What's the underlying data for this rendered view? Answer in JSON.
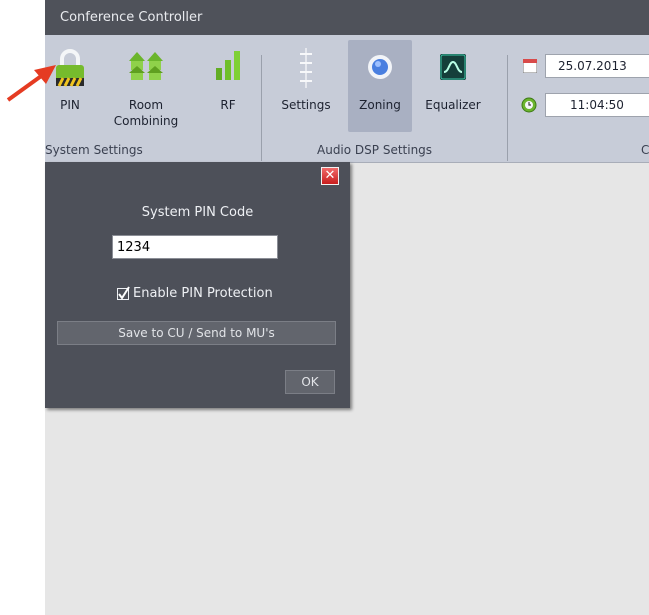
{
  "window": {
    "title": "Conference Controller"
  },
  "ribbon": {
    "buttons": [
      {
        "label": "PIN",
        "icon": "lock-icon"
      },
      {
        "label": "Room\nCombining",
        "icon": "room-combining-icon"
      },
      {
        "label": "RF",
        "icon": "signal-bars-icon"
      },
      {
        "label": "Settings",
        "icon": "sliders-icon"
      },
      {
        "label": "Zoning",
        "icon": "zoning-icon",
        "active": true
      },
      {
        "label": "Equalizer",
        "icon": "equalizer-icon"
      }
    ],
    "groups": [
      "System Settings",
      "Audio DSP Settings",
      "C"
    ],
    "date": "25.07.2013",
    "time": "11:04:50"
  },
  "dialog": {
    "close_label": "✕",
    "pin_label": "System PIN Code",
    "pin_value": "1234",
    "checkbox_label": "Enable PIN Protection",
    "checkbox_checked": true,
    "save_label": "Save to CU / Send to MU's",
    "ok_label": "OK"
  },
  "colors": {
    "titlebar": "#4f525a",
    "ribbon": "#c7ccd8",
    "dialog": "#4d5059",
    "accent_green": "#5fa020",
    "arrow": "#e53b22"
  }
}
